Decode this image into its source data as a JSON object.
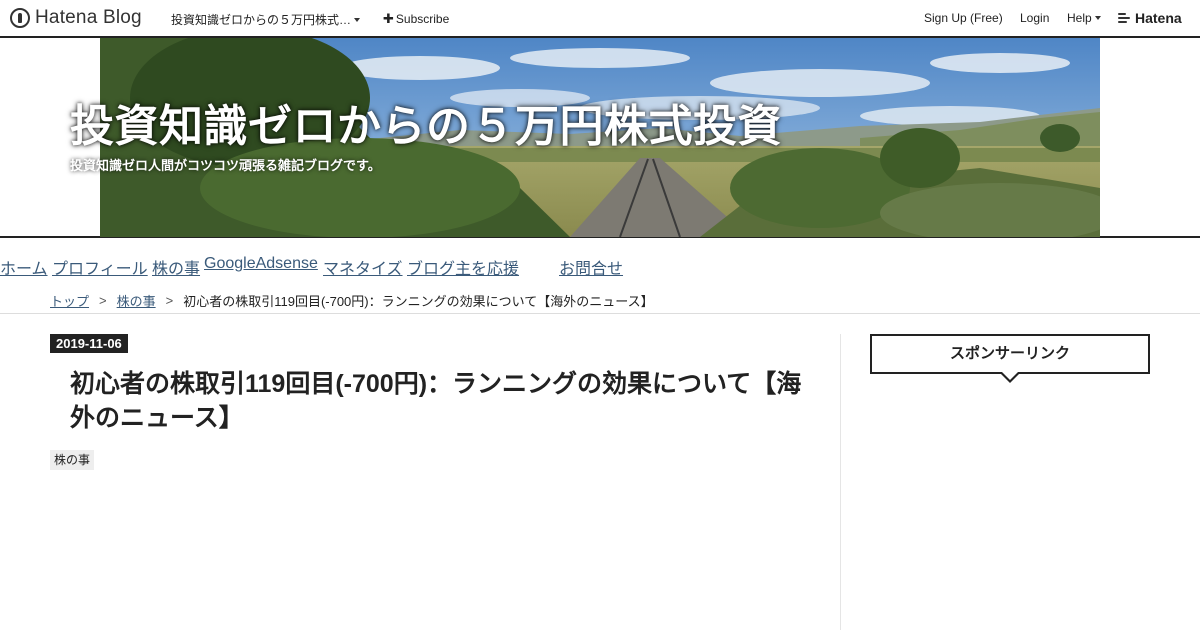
{
  "topbar": {
    "logo_text": "Hatena Blog",
    "blog_menu_label": "投資知識ゼロからの５万円株式…",
    "subscribe_label": "Subscribe",
    "signup_label": "Sign Up (Free)",
    "login_label": "Login",
    "help_label": "Help",
    "brand_label": "Hatena"
  },
  "header": {
    "title": "投資知識ゼロからの５万円株式投資",
    "description": "投資知識ゼロ人間がコツコツ頑張る雑記ブログです。"
  },
  "global_nav": {
    "items": [
      {
        "label": "ホーム"
      },
      {
        "label": "プロフィール"
      },
      {
        "label": "株の事"
      },
      {
        "label": "GoogleAdsense"
      },
      {
        "label": "マネタイズ"
      },
      {
        "label": "ブログ主を応援"
      },
      {
        "label": "お問合せ"
      }
    ]
  },
  "breadcrumb": {
    "home": "トップ",
    "category": "株の事",
    "current": "初心者の株取引119回目(-700円)：ランニングの効果について【海外のニュース】",
    "separator": ">"
  },
  "entry": {
    "date": "2019-11-06",
    "title": "初心者の株取引119回目(-700円)：ランニングの効果について【海外のニュース】",
    "category": "株の事"
  },
  "sidebar": {
    "sponsor_title": "スポンサーリンク"
  },
  "colors": {
    "link": "#3a5a7a",
    "text": "#222222",
    "badge_bg": "#222222"
  }
}
